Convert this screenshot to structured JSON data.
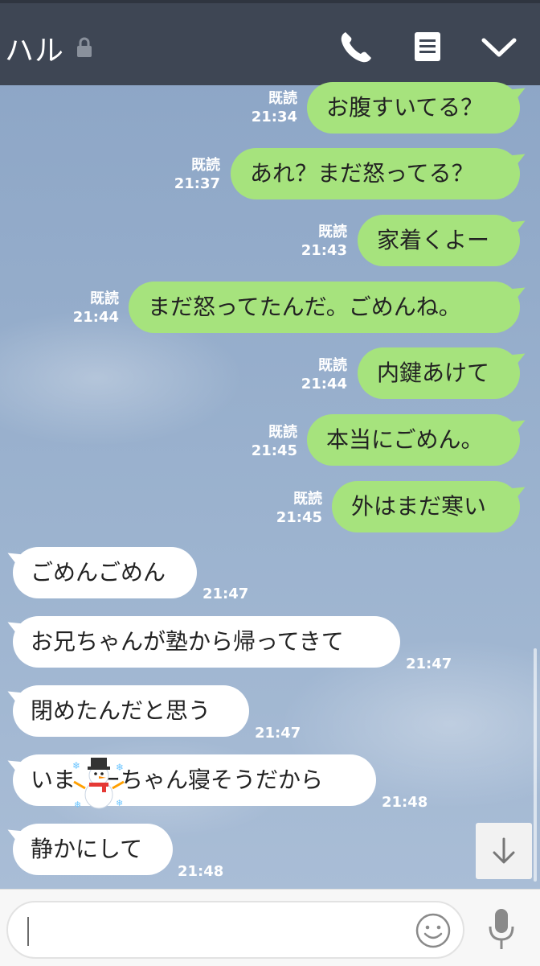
{
  "header": {
    "title": "ハル"
  },
  "outgoing": [
    {
      "text": "お腹すいてる？",
      "read": "既読",
      "time": "21:34"
    },
    {
      "text": "あれ？まだ怒ってる？",
      "read": "既読",
      "time": "21:37"
    },
    {
      "text": "家着くよー",
      "read": "既読",
      "time": "21:43"
    },
    {
      "text": "まだ怒ってたんだ。ごめんね。",
      "read": "既読",
      "time": "21:44"
    },
    {
      "text": "内鍵あけて",
      "read": "既読",
      "time": "21:44"
    },
    {
      "text": "本当にごめん。",
      "read": "既読",
      "time": "21:45"
    },
    {
      "text": "外はまだ寒い",
      "read": "既読",
      "time": "21:45"
    }
  ],
  "incoming": [
    {
      "text": "ごめんごめん",
      "time": "21:47"
    },
    {
      "text": "お兄ちゃんが塾から帰ってきて",
      "time": "21:47"
    },
    {
      "text": "閉めたんだと思う",
      "time": "21:47"
    },
    {
      "text": "いま　ーちゃん寝そうだから",
      "time": "21:48"
    },
    {
      "text": "静かにして",
      "time": "21:48"
    }
  ],
  "input": {
    "placeholder": ""
  },
  "icons": {
    "lock": "lock-icon",
    "call": "phone-icon",
    "notes": "note-icon",
    "menu": "chevron-down-icon",
    "scroll": "arrow-down-icon",
    "emoji": "emoji-icon",
    "mic": "microphone-icon",
    "sticker": "snowman-emoji"
  },
  "colors": {
    "header": "#3e4654",
    "outgoing_bubble": "#a6e37d",
    "incoming_bubble": "#ffffff"
  }
}
